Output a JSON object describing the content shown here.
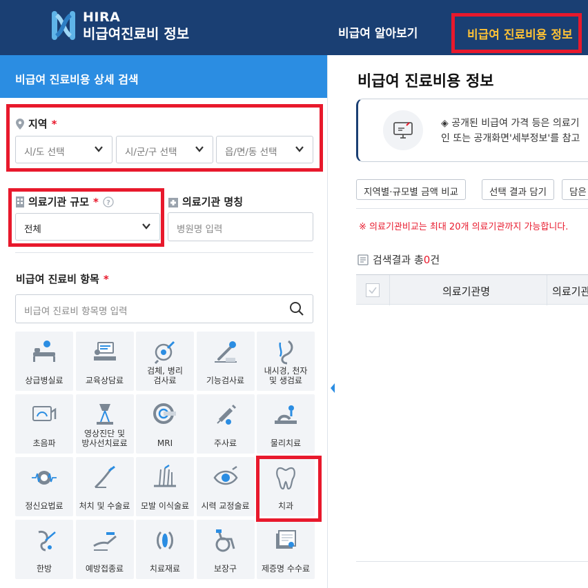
{
  "header": {
    "logo_line1": "HIRA",
    "logo_line2": "비급여진료비 정보",
    "nav": [
      "비급여 알아보기",
      "비급여 진료비용 정보"
    ]
  },
  "left": {
    "title": "비급여 진료비용 상세 검색",
    "region": {
      "label": "지역",
      "required": "*",
      "selects": [
        "시/도 선택",
        "시/군/구 선택",
        "읍/면/동 선택"
      ]
    },
    "scale": {
      "label": "의료기관 규모",
      "required": "*",
      "value": "전체"
    },
    "name": {
      "label": "의료기관 명칭",
      "placeholder": "병원명 입력"
    },
    "items": {
      "label": "비급여 진료비 항목",
      "required": "*",
      "search_placeholder": "비급여 진료비 항목명 입력",
      "tiles": [
        {
          "label": "상급병실료",
          "icon": "hospital-bed-icon"
        },
        {
          "label": "교육상담료",
          "icon": "counseling-icon"
        },
        {
          "label": "검체, 병리\n검사료",
          "icon": "specimen-icon"
        },
        {
          "label": "기능검사료",
          "icon": "function-test-icon"
        },
        {
          "label": "내시경, 천자\n및 생검료",
          "icon": "endoscope-icon"
        },
        {
          "label": "초음파",
          "icon": "ultrasound-icon"
        },
        {
          "label": "영상진단 및\n방사선치료료",
          "icon": "radiology-icon"
        },
        {
          "label": "MRI",
          "icon": "mri-icon"
        },
        {
          "label": "주사료",
          "icon": "syringe-icon"
        },
        {
          "label": "물리치료",
          "icon": "physical-therapy-icon"
        },
        {
          "label": "정신요법료",
          "icon": "psychotherapy-icon"
        },
        {
          "label": "처치 및 수술료",
          "icon": "surgery-icon"
        },
        {
          "label": "모발 이식술료",
          "icon": "hair-transplant-icon"
        },
        {
          "label": "시력 교정술료",
          "icon": "eye-icon"
        },
        {
          "label": "치과",
          "icon": "tooth-icon"
        },
        {
          "label": "한방",
          "icon": "acupuncture-icon"
        },
        {
          "label": "예방접종료",
          "icon": "vaccination-icon"
        },
        {
          "label": "치료재료",
          "icon": "treatment-material-icon"
        },
        {
          "label": "보장구",
          "icon": "wheelchair-icon"
        },
        {
          "label": "제증명 수수료",
          "icon": "certificate-icon"
        }
      ]
    }
  },
  "right": {
    "title": "비급여 진료비용 정보",
    "notice_line1": "◈ 공개된 비급여 가격 등은 의료기",
    "notice_line2": "인 또는 공개화면'세부정보'를 참고",
    "buttons": [
      "지역별·규모별 금액 비교",
      "선택 결과 담기",
      "담은"
    ],
    "warning": "※ 의료기관비교는 최대 20개 의료기관까지 가능합니다.",
    "result_prefix": "검색결과 총",
    "result_count": "0",
    "result_suffix": "건",
    "columns": [
      "의료기관명",
      "의료기관"
    ]
  }
}
